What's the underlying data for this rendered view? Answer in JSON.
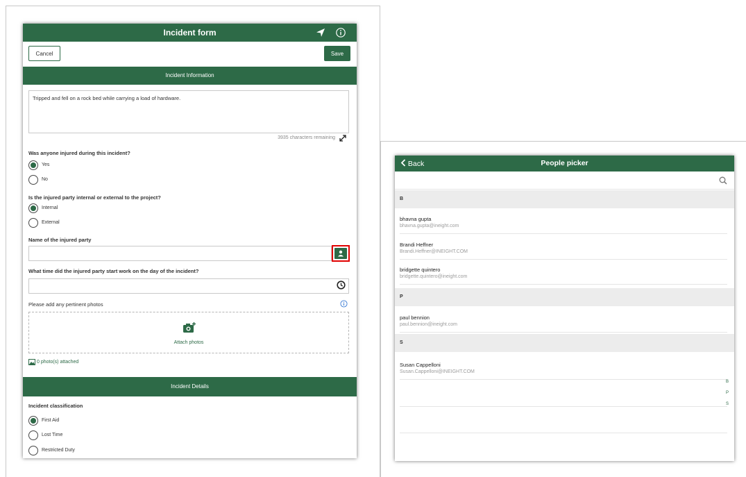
{
  "incident_form": {
    "title": "Incident form",
    "cancel_label": "Cancel",
    "save_label": "Save",
    "section_info": "Incident Information",
    "description_text": "Tripped and fell on a rock bed while carrying a load of hardware.",
    "chars_remaining": "3935 characters remaining",
    "q_injured": "Was anyone injured during this incident?",
    "opt_yes": "Yes",
    "opt_no": "No",
    "q_internal": "Is the injured party internal or external to the project?",
    "opt_internal": "Internal",
    "opt_external": "External",
    "q_name": "Name of the injured party",
    "name_value": "",
    "q_time": "What time did the injured party start work on the day of the incident?",
    "time_value": "",
    "q_photos": "Please add any pertinent photos",
    "attach_label": "Attach photos",
    "photos_attached": "0 photo(s) attached",
    "section_details": "Incident Details",
    "q_classification": "Incident classification",
    "opt_first_aid": "First Aid",
    "opt_lost_time": "Lost Time",
    "opt_restricted": "Restricted Duty"
  },
  "people_picker": {
    "back_label": "Back",
    "title": "People picker",
    "search_value": "",
    "sections": [
      {
        "letter": "B",
        "people": [
          {
            "name": "bhavna gupta",
            "email": "bhavna.gupta@ineight.com"
          },
          {
            "name": "Brandi Heffner",
            "email": "Brandi.Heffner@INEIGHT.COM"
          },
          {
            "name": "bridgette quintero",
            "email": "bridgette.quintero@ineight.com"
          }
        ]
      },
      {
        "letter": "P",
        "people": [
          {
            "name": "paul bennion",
            "email": "paul.bennion@ineight.com"
          }
        ]
      },
      {
        "letter": "S",
        "people": [
          {
            "name": "Susan Cappelloni",
            "email": "Susan.Cappelloni@INEIGHT.COM"
          }
        ]
      }
    ],
    "index": [
      "B",
      "P",
      "S"
    ]
  },
  "colors": {
    "brand_green": "#2d6a47",
    "highlight_red": "#e00000"
  },
  "icons": [
    "navigation-arrow-icon",
    "info-icon",
    "expand-icon",
    "person-icon",
    "clock-icon",
    "add-photo-icon",
    "image-icon",
    "back-chevron-icon",
    "search-icon"
  ]
}
